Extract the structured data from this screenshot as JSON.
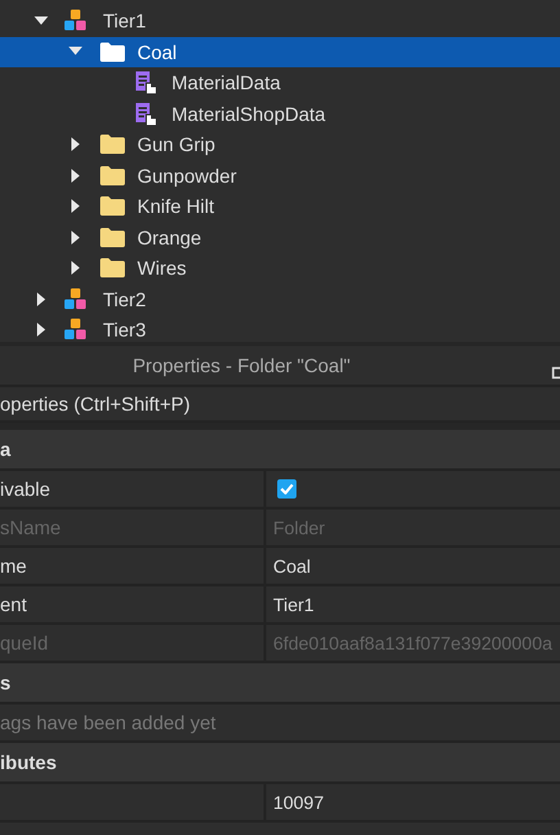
{
  "explorer": {
    "items": [
      {
        "label": "Tier1",
        "kind": "model",
        "expanded": true,
        "selected": false,
        "children": [
          {
            "label": "Coal",
            "kind": "folder",
            "expanded": true,
            "selected": true,
            "children": [
              {
                "label": "MaterialData",
                "kind": "script",
                "selected": false
              },
              {
                "label": "MaterialShopData",
                "kind": "script",
                "selected": false
              }
            ]
          },
          {
            "label": "Gun Grip",
            "kind": "folder",
            "expanded": false,
            "selected": false
          },
          {
            "label": "Gunpowder",
            "kind": "folder",
            "expanded": false,
            "selected": false
          },
          {
            "label": "Knife Hilt",
            "kind": "folder",
            "expanded": false,
            "selected": false
          },
          {
            "label": "Orange",
            "kind": "folder",
            "expanded": false,
            "selected": false
          },
          {
            "label": "Wires",
            "kind": "folder",
            "expanded": false,
            "selected": false
          }
        ]
      },
      {
        "label": "Tier2",
        "kind": "model",
        "expanded": false,
        "selected": false
      },
      {
        "label": "Tier3",
        "kind": "model",
        "expanded": false,
        "selected": false
      }
    ]
  },
  "properties": {
    "title": "Properties - Folder \"Coal\"",
    "filter": {
      "placeholder": "operties (Ctrl+Shift+P)"
    },
    "sections": [
      {
        "title": "a",
        "rows": [
          {
            "kind": "checkbox",
            "name": "ivable",
            "checked": true
          },
          {
            "kind": "text",
            "name": "sName",
            "value": "Folder",
            "disabled": true
          },
          {
            "kind": "text",
            "name": "me",
            "value": "Coal",
            "disabled": false
          },
          {
            "kind": "text",
            "name": "ent",
            "value": "Tier1",
            "disabled": false
          },
          {
            "kind": "text",
            "name": "queId",
            "value": "6fde010aaf8a131f077e39200000a",
            "disabled": true
          }
        ]
      },
      {
        "title": "s",
        "rows": [
          {
            "kind": "note",
            "text": "ags have been added yet"
          }
        ]
      },
      {
        "title": "ibutes",
        "rows": [
          {
            "kind": "text",
            "value": "10097",
            "disabled": false
          }
        ]
      }
    ]
  }
}
